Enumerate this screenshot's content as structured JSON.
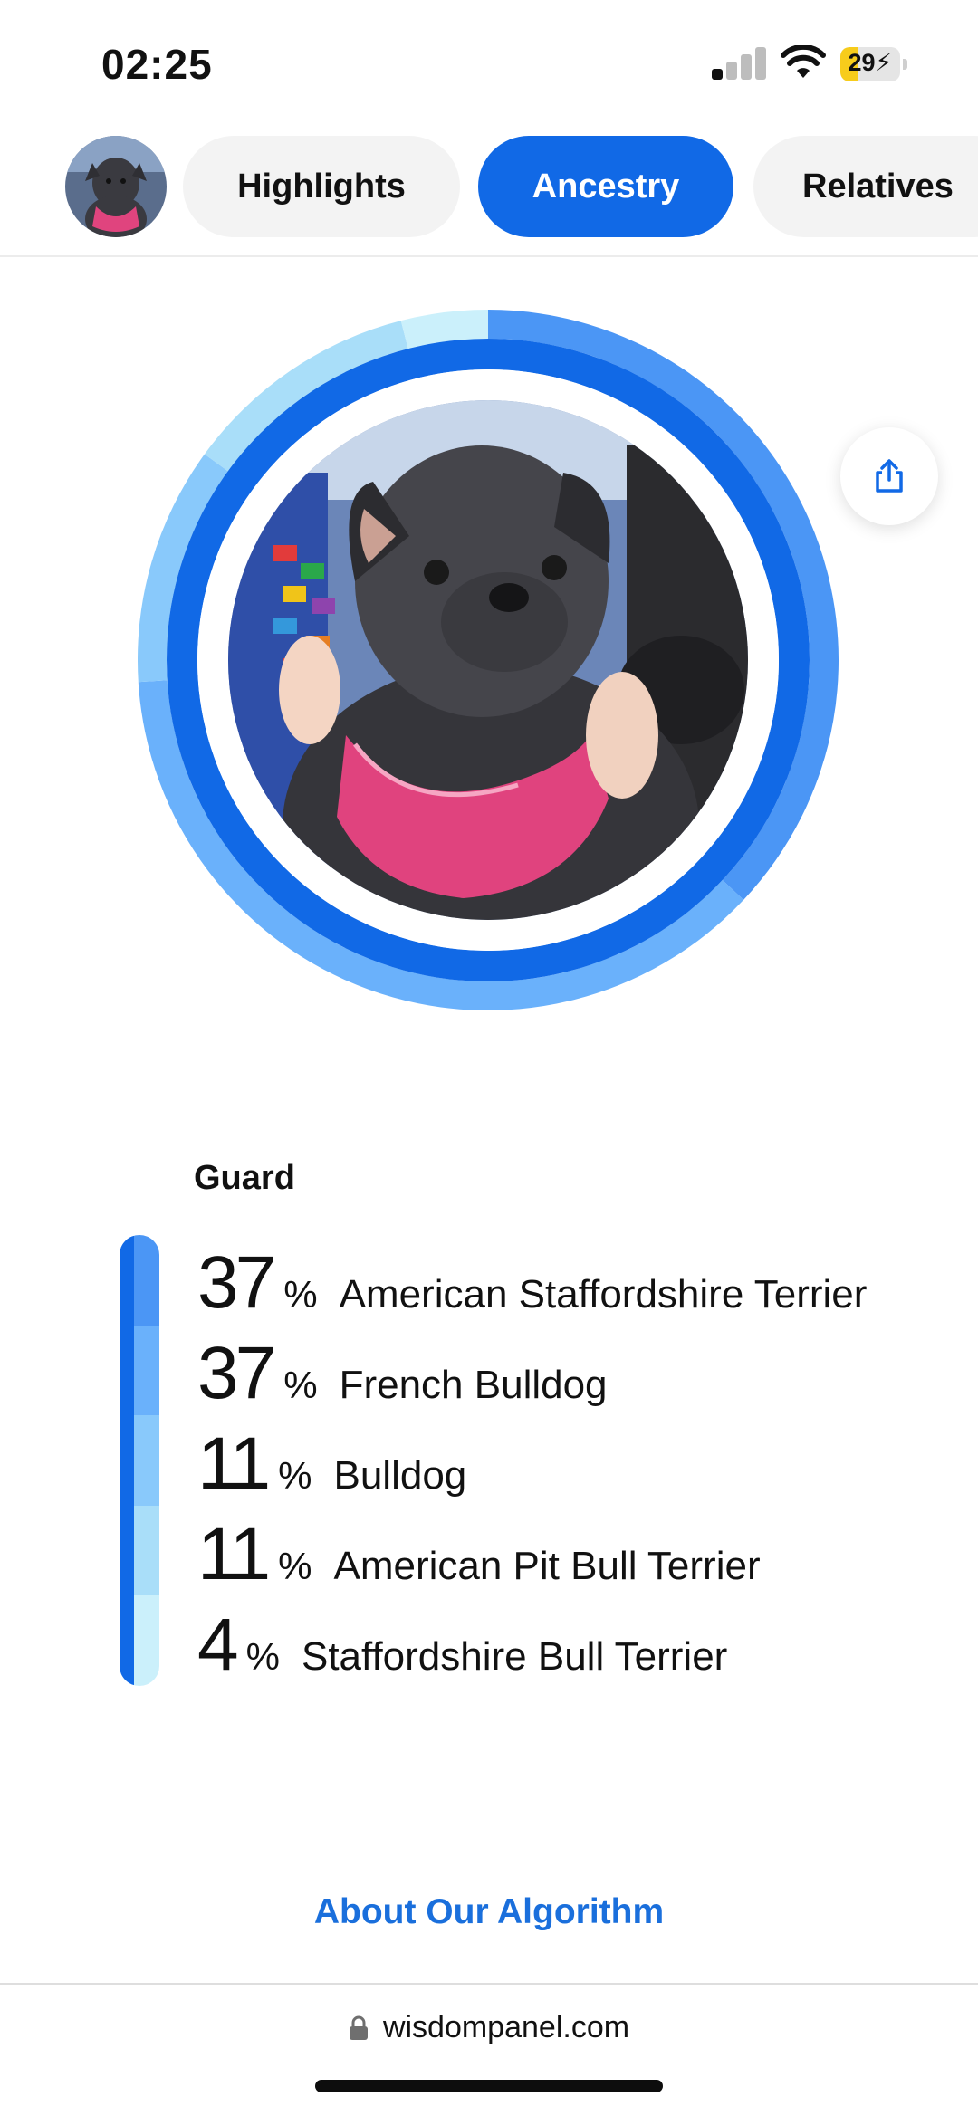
{
  "status_bar": {
    "time": "02:25",
    "battery": "29"
  },
  "nav": {
    "tabs": [
      {
        "label": "Highlights",
        "active": false
      },
      {
        "label": "Ancestry",
        "active": true
      },
      {
        "label": "Relatives",
        "active": false
      }
    ],
    "avatar_icon": "dog-avatar-icon"
  },
  "ring": {
    "inner_color": "#1169e6",
    "segments": [
      {
        "breed": "American Staffordshire Terrier",
        "percent": 37,
        "color": "#4b96f5"
      },
      {
        "breed": "French Bulldog",
        "percent": 37,
        "color": "#6ab1fb"
      },
      {
        "breed": "Bulldog",
        "percent": 11,
        "color": "#89c9fb"
      },
      {
        "breed": "American Pit Bull Terrier",
        "percent": 11,
        "color": "#a9def9"
      },
      {
        "breed": "Staffordshire Bull Terrier",
        "percent": 4,
        "color": "#cbf0fb"
      }
    ]
  },
  "share_icon": "share-icon",
  "breakdown": {
    "group_label": "Guard",
    "percent_symbol": "%",
    "rows": [
      {
        "percent": "37",
        "breed": "American Staffordshire Terrier"
      },
      {
        "percent": "37",
        "breed": "French Bulldog"
      },
      {
        "percent": "11",
        "breed": "Bulldog"
      },
      {
        "percent": "11",
        "breed": "American Pit Bull Terrier"
      },
      {
        "percent": "4",
        "breed": "Staffordshire Bull Terrier"
      }
    ]
  },
  "algorithm_link": "About Our Algorithm",
  "footer": {
    "url": "wisdompanel.com",
    "lock_icon": "lock-icon"
  }
}
